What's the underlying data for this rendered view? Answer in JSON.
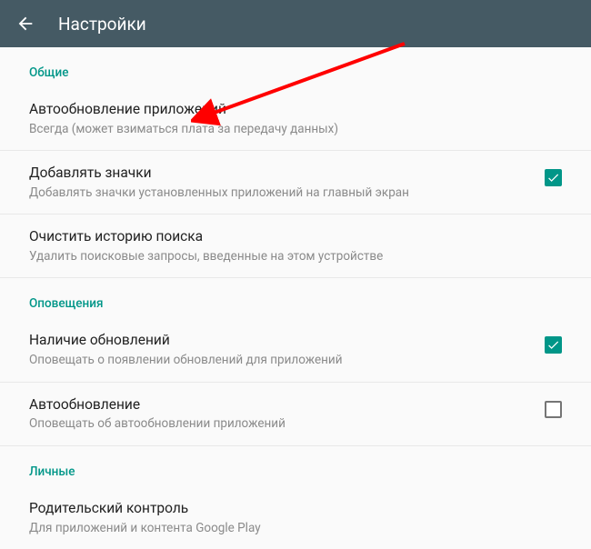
{
  "header": {
    "title": "Настройки"
  },
  "sections": {
    "general": {
      "label": "Общие",
      "auto_update_apps": {
        "title": "Автообновление приложений",
        "subtitle": "Всегда (может взиматься плата за передачу данных)"
      },
      "add_icons": {
        "title": "Добавлять значки",
        "subtitle": "Добавлять значки установленных приложений на главный экран",
        "checked": true
      },
      "clear_search_history": {
        "title": "Очистить историю поиска",
        "subtitle": "Удалить поисковые запросы, введенные на этом устройстве"
      }
    },
    "notifications": {
      "label": "Оповещения",
      "updates_available": {
        "title": "Наличие обновлений",
        "subtitle": "Оповещать о появлении обновлений для приложений",
        "checked": true
      },
      "auto_update": {
        "title": "Автообновление",
        "subtitle": "Оповещать об автообновлении приложений",
        "checked": false
      }
    },
    "personal": {
      "label": "Личные",
      "parental_control": {
        "title": "Родительский контроль",
        "subtitle": "Для приложений и контента Google Play"
      }
    }
  },
  "colors": {
    "accent": "#009688",
    "appbar": "#455a64",
    "arrow": "#ff0000"
  }
}
